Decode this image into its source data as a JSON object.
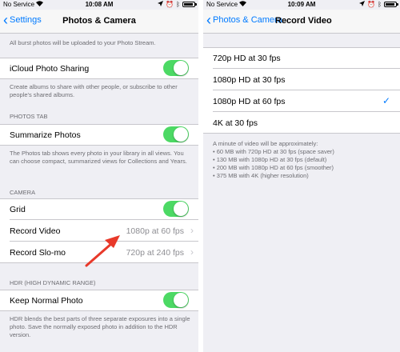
{
  "colors": {
    "accent": "#007aff",
    "toggle_on": "#4cd964",
    "arrow": "#e8392a"
  },
  "left": {
    "status": {
      "carrier": "No Service",
      "time": "10:08 AM"
    },
    "nav": {
      "back_label": "Settings",
      "title": "Photos & Camera"
    },
    "burst_footer": "All burst photos will be uploaded to your Photo Stream.",
    "icloud": {
      "label": "iCloud Photo Sharing",
      "on": true,
      "footer": "Create albums to share with other people, or subscribe to other people's shared albums."
    },
    "photos_tab": {
      "header": "PHOTOS TAB",
      "summarize_label": "Summarize Photos",
      "summarize_on": true,
      "footer": "The Photos tab shows every photo in your library in all views. You can choose compact, summarized views for Collections and Years."
    },
    "camera": {
      "header": "CAMERA",
      "grid_label": "Grid",
      "grid_on": true,
      "record_video_label": "Record Video",
      "record_video_value": "1080p at 60 fps",
      "slomo_label": "Record Slo-mo",
      "slomo_value": "720p at 240 fps"
    },
    "hdr": {
      "header": "HDR (HIGH DYNAMIC RANGE)",
      "keep_label": "Keep Normal Photo",
      "keep_on": true,
      "footer": "HDR blends the best parts of three separate exposures into a single photo. Save the normally exposed photo in addition to the HDR version."
    }
  },
  "right": {
    "status": {
      "carrier": "No Service",
      "time": "10:09 AM"
    },
    "nav": {
      "back_label": "Photos & Camera",
      "title": "Record Video"
    },
    "options": [
      {
        "label": "720p HD at 30 fps",
        "selected": false
      },
      {
        "label": "1080p HD at 30 fps",
        "selected": false
      },
      {
        "label": "1080p HD at 60 fps",
        "selected": true
      },
      {
        "label": "4K at 30 fps",
        "selected": false
      }
    ],
    "footer_intro": "A minute of video will be approximately:",
    "footer_items": [
      "• 60 MB with 720p HD at 30 fps (space saver)",
      "• 130 MB with 1080p HD at 30 fps (default)",
      "• 200 MB with 1080p HD at 60 fps (smoother)",
      "• 375 MB with 4K (higher resolution)"
    ]
  }
}
